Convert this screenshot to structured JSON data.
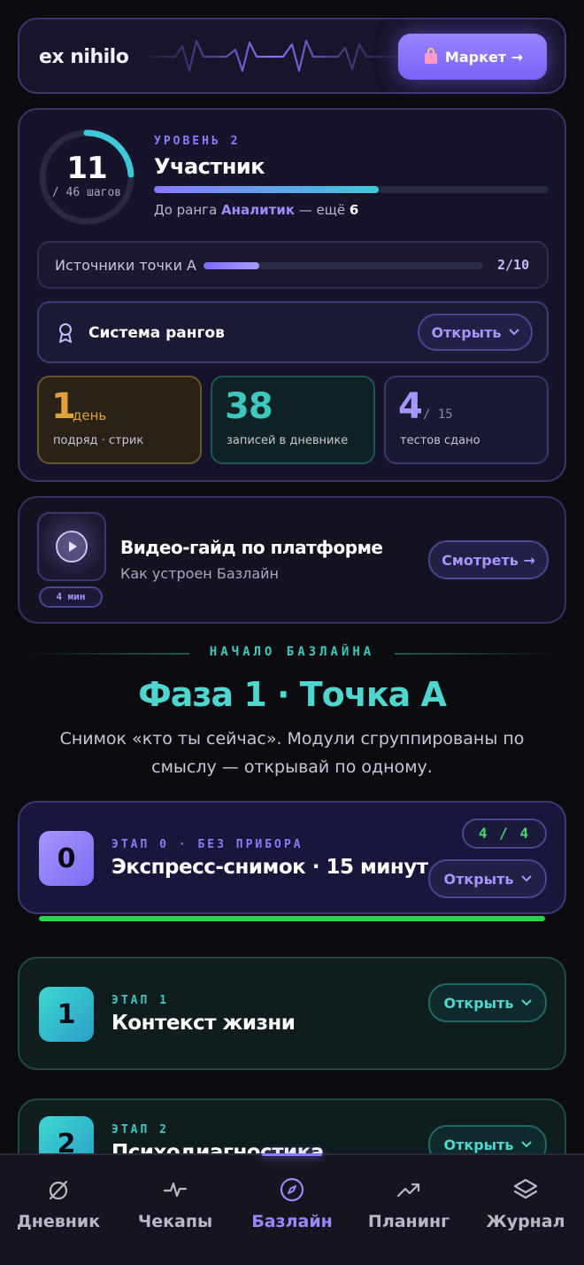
{
  "header": {
    "brand": "ex nihilo",
    "market_label": "Маркет →",
    "market_icon": "shopping-bag-icon"
  },
  "level": {
    "steps_done": "11",
    "steps_total_label": "/ 46 шагов",
    "steps_progress": 0.24,
    "level_label": "УРОВЕНЬ 2",
    "rank_name": "Участник",
    "rank_progress": 0.57,
    "next_prefix": "До ранга ",
    "next_rank": "Аналитик",
    "next_middle": " — ещё ",
    "next_count": "6"
  },
  "sources": {
    "label": "Источники точки А",
    "count": "2/10",
    "progress": 0.2
  },
  "ranks_system": {
    "label": "Система рангов",
    "button": "Открыть"
  },
  "stats": [
    {
      "value": "1",
      "unit": "день",
      "desc": "подряд · стрик",
      "color": "#e0a23a"
    },
    {
      "value": "38",
      "unit": "",
      "desc": "записей в дневнике",
      "color": "#3ec8c0"
    },
    {
      "value": "4",
      "unit": "/ 15",
      "desc": "тестов сдано",
      "color": "#a596ff"
    }
  ],
  "video": {
    "duration": "4 мин",
    "title": "Видео-гайд по платформе",
    "subtitle": "Как устроен Базлайн",
    "button": "Смотреть →"
  },
  "phase": {
    "kicker": "НАЧАЛО БАЗЛАЙНА",
    "title": "Фаза 1 · Точка А",
    "description": "Снимок «кто ты сейчас». Модули сгруппированы по смыслу — открывай по одному."
  },
  "stages": [
    {
      "num": "0",
      "kicker": "ЭТАП 0 · БЕЗ ПРИБОРА",
      "title": "Экспресс-снимок · 15 минут",
      "progress": "4 / 4",
      "button": "Открыть"
    },
    {
      "num": "1",
      "kicker": "ЭТАП 1",
      "title": "Контекст жизни",
      "button": "Открыть"
    },
    {
      "num": "2",
      "kicker": "ЭТАП 2",
      "title": "Психодиагностика",
      "button": "Открыть"
    }
  ],
  "nav": [
    {
      "label": "Дневник",
      "icon": "diary-icon",
      "active": false
    },
    {
      "label": "Чекапы",
      "icon": "pulse-icon",
      "active": false
    },
    {
      "label": "Базлайн",
      "icon": "compass-icon",
      "active": true
    },
    {
      "label": "Планинг",
      "icon": "trend-icon",
      "active": false
    },
    {
      "label": "Журнал",
      "icon": "layers-icon",
      "active": false
    }
  ],
  "colors": {
    "accent": "#8a78ff",
    "teal": "#3ec8c0",
    "green": "#2ad24f",
    "background": "#0b0b10"
  }
}
